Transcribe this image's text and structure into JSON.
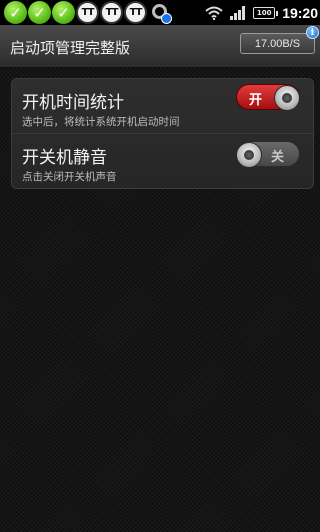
{
  "status_bar": {
    "time": "19:20",
    "battery_text": "100",
    "notification_icons": [
      "check-icon",
      "check-icon",
      "check-icon",
      "tt-icon",
      "tt-icon",
      "tt-icon",
      "sync-icon"
    ],
    "tt_label": "TT"
  },
  "header": {
    "title": "启动项管理完整版",
    "speed": "17.00B/S",
    "info_glyph": "i"
  },
  "settings": [
    {
      "title": "开机时间统计",
      "description": "选中后，将统计系统开机启动时间",
      "toggle_label": "开",
      "enabled": true
    },
    {
      "title": "开关机静音",
      "description": "点击关闭开关机声音",
      "toggle_label": "关",
      "enabled": false
    }
  ],
  "colors": {
    "toggle_on": "#c4181c",
    "toggle_off": "#555555",
    "background": "#141414"
  }
}
